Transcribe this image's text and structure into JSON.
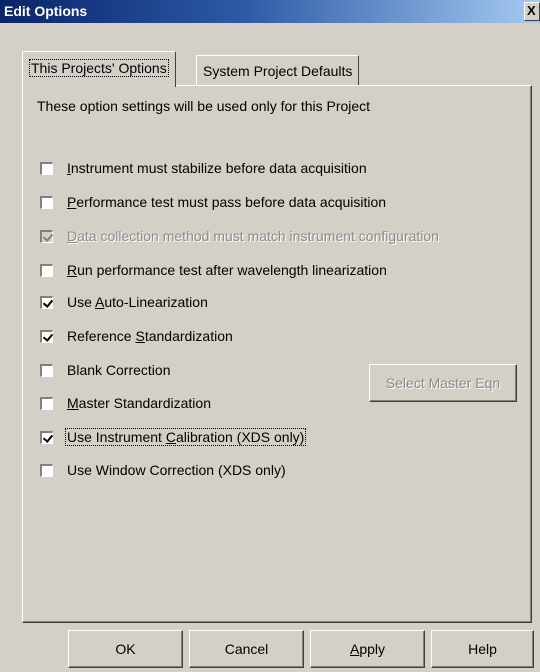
{
  "window": {
    "title": "Edit Options",
    "close_glyph": "X"
  },
  "tabs": [
    {
      "label": "This Projects' Options",
      "active": true
    },
    {
      "label": "System Project Defaults",
      "active": false
    }
  ],
  "info_text": "These option settings will be used only for this Project",
  "options": [
    {
      "pre": "",
      "key": "I",
      "post": "nstrument must stabilize before data acquisition",
      "checked": false,
      "disabled": false
    },
    {
      "pre": "",
      "key": "P",
      "post": "erformance test must pass before data acquisition",
      "checked": false,
      "disabled": false
    },
    {
      "pre": "",
      "key": "D",
      "post": "ata collection method must match instrument configuration",
      "checked": true,
      "disabled": true
    },
    {
      "pre": "",
      "key": "R",
      "post": "un performance test after wavelength linearization",
      "checked": false,
      "disabled": false
    },
    {
      "pre": "Use ",
      "key": "A",
      "post": "uto-Linearization",
      "checked": true,
      "disabled": false
    },
    {
      "pre": "Reference ",
      "key": "S",
      "post": "tandardization",
      "checked": true,
      "disabled": false
    },
    {
      "pre": "Blank Correction",
      "key": "",
      "post": "",
      "checked": false,
      "disabled": false
    },
    {
      "pre": "",
      "key": "M",
      "post": "aster Standardization",
      "checked": false,
      "disabled": false
    },
    {
      "pre": "Use Instrument ",
      "key": "C",
      "post": "alibration (XDS only)",
      "checked": true,
      "disabled": false,
      "focused": true
    },
    {
      "pre": "Use Window Correction (XDS only)",
      "key": "",
      "post": "",
      "checked": false,
      "disabled": false
    }
  ],
  "select_master_eqn_label": "Select Master Eqn",
  "buttons": {
    "ok": "OK",
    "cancel": "Cancel",
    "apply_pre": "",
    "apply_key": "A",
    "apply_post": "pply",
    "help": "Help"
  },
  "icons": {
    "close": "close-icon",
    "check": "check-mark-icon"
  }
}
